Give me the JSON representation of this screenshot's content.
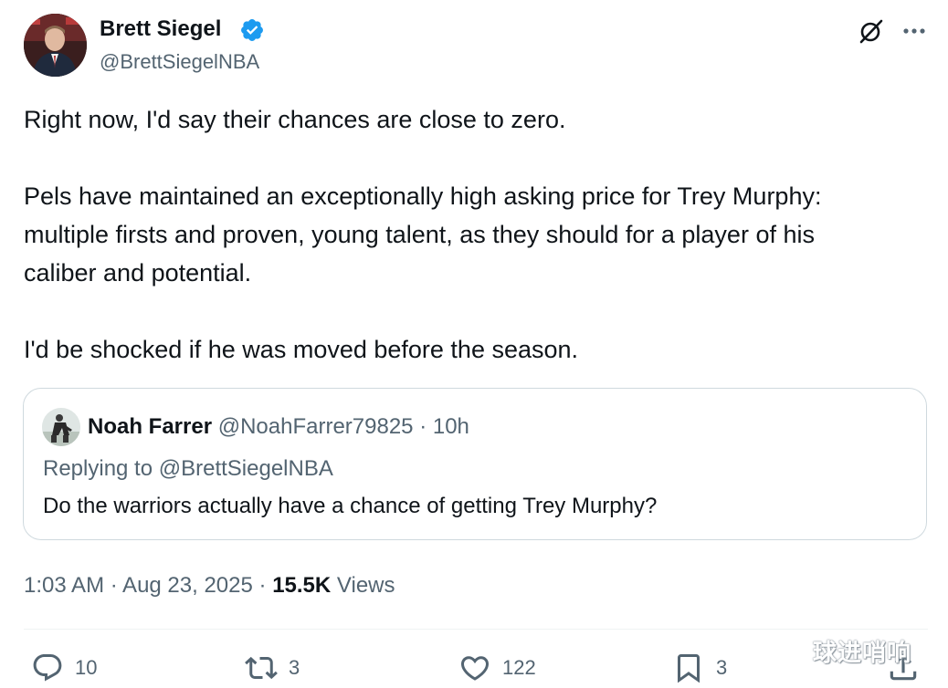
{
  "author": {
    "name": "Brett Siegel",
    "handle": "@BrettSiegelNBA",
    "verified": true
  },
  "header_icons": [
    "grok-icon",
    "more-icon"
  ],
  "tweet": {
    "paragraphs": [
      "Right now, I'd say their chances are close to zero.",
      "Pels have maintained an exceptionally high asking price for Trey Murphy:",
      "multiple firsts and proven, young talent, as they should for a player of his",
      "caliber and potential.",
      "I'd be shocked if he was moved before the season."
    ]
  },
  "quote": {
    "name": "Noah Farrer",
    "meta": "@NoahFarrer79825 · 10h",
    "replying_to": "Replying to @BrettSiegelNBA",
    "text": "Do the warriors actually have a chance of getting Trey Murphy?"
  },
  "timestamp": "1:03 AM · Aug 23, 2025 · ",
  "views": {
    "count": "15.5K",
    "label": "Views"
  },
  "actions": {
    "replies": "10",
    "reposts": "3",
    "likes": "122",
    "bookmarks": "3"
  },
  "watermark": "球进哨响",
  "colors": {
    "text_primary": "#0f1419",
    "text_secondary": "#536471",
    "verified_blue": "#1d9bf0",
    "border": "#cfd9de"
  }
}
